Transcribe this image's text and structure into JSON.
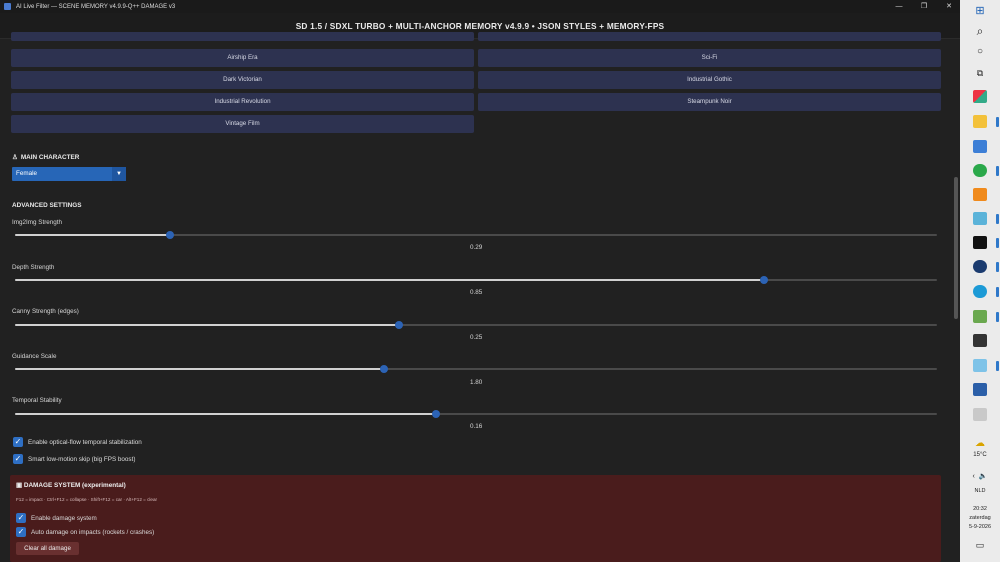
{
  "window": {
    "title": "AI Live Filter — SCENE MEMORY v4.9.9-Q++ DAMAGE v3",
    "minimize": "—",
    "maximize": "❐",
    "close": "✕"
  },
  "header": {
    "title": "SD 1.5 / SDXL TURBO + MULTI-ANCHOR MEMORY v4.9.9  •  JSON STYLES + MEMORY-FPS"
  },
  "styles": [
    "Airship Era",
    "Sci-Fi",
    "Dark Victorian",
    "Industrial Gothic",
    "Industrial Revolution",
    "Steampunk Noir",
    "Vintage Film"
  ],
  "main_character": {
    "heading": "MAIN CHARACTER",
    "icon": "person-icon",
    "selected": "Female"
  },
  "advanced": {
    "heading": "ADVANCED SETTINGS",
    "sliders": [
      {
        "label": "Img2Img Strength",
        "value": "0.29",
        "position": 0.168
      },
      {
        "label": "Depth Strength",
        "value": "0.85",
        "position": 0.812
      },
      {
        "label": "Canny Strength (edges)",
        "value": "0.25",
        "position": 0.417
      },
      {
        "label": "Guidance Scale",
        "value": "1.80",
        "position": 0.4
      },
      {
        "label": "Temporal Stability",
        "value": "0.16",
        "position": 0.457
      }
    ],
    "checkboxes": [
      {
        "label": "Enable optical-flow temporal stabilization",
        "checked": true
      },
      {
        "label": "Smart low-motion skip (big FPS boost)",
        "checked": true
      }
    ]
  },
  "damage": {
    "heading": "DAMAGE SYSTEM (experimental)",
    "icon": "damage-icon",
    "keys": "F12 = impact · Ctrl+F12 = collapse · Shift+F12 = car · Alt+F12 = clear",
    "checkboxes": [
      {
        "label": "Enable damage system",
        "checked": true
      },
      {
        "label": "Auto damage on impacts (rockets / crashes)",
        "checked": true
      }
    ],
    "clear_button": "Clear all damage"
  },
  "taskbar": {
    "weather": "15°C",
    "language": "NLD",
    "time": "20:32",
    "day": "zaterdag",
    "date": "5-9-2026"
  },
  "colors": {
    "accent": "#2c63b5",
    "style_button": "#2d3250",
    "damage_panel": "#4a1c1c"
  }
}
